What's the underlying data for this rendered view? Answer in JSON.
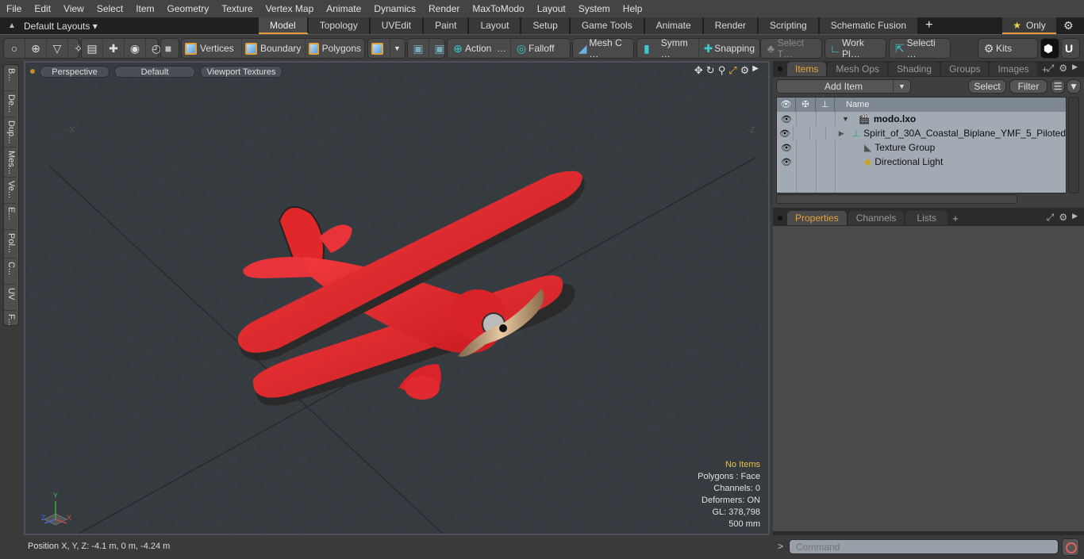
{
  "menu": [
    "File",
    "Edit",
    "View",
    "Select",
    "Item",
    "Geometry",
    "Texture",
    "Vertex Map",
    "Animate",
    "Dynamics",
    "Render",
    "MaxToModo",
    "Layout",
    "System",
    "Help"
  ],
  "layoutbar": {
    "layouts_dropdown": "Default Layouts ▾",
    "tabs": [
      "Model",
      "Topology",
      "UVEdit",
      "Paint",
      "Layout",
      "Setup",
      "Game Tools",
      "Animate",
      "Render",
      "Scripting",
      "Schematic Fusion"
    ],
    "active_tab": "Model",
    "add_tab": "+",
    "only_label": "Only",
    "star": "★"
  },
  "toolbar": {
    "vertices": "Vertices",
    "boundary": "Boundary",
    "polygons": "Polygons",
    "action": "Action",
    "falloff": "Falloff",
    "mesh_c": "Mesh C …",
    "symm": "Symm …",
    "snapping": "Snapping",
    "select_t": "Select T…",
    "work_pl": "Work Pl…",
    "selecti": "Selecti …",
    "kits": "Kits",
    "ellipsis": "…"
  },
  "left_tools": [
    "B...",
    "De...",
    "Dup...",
    "Mes...",
    "Ve...",
    "E...",
    "Pol...",
    "C...",
    "UV",
    "F..."
  ],
  "viewport": {
    "view_mode": "Perspective",
    "shading": "Default",
    "textures": "Viewport Textures",
    "axis_neg_x": "-X",
    "axis_neg_z": "-Z",
    "gizmo": {
      "x": "X",
      "y": "Y",
      "z": "Z"
    },
    "hud": {
      "selection": "No Items",
      "polygons": "Polygons : Face",
      "channels": "Channels: 0",
      "deformers": "Deformers: ON",
      "gl": "GL: 378,798",
      "scale": "500 mm"
    }
  },
  "status": {
    "position": "Position X, Y, Z:   -4.1 m, 0 m, -4.24 m"
  },
  "items_panel": {
    "tabs": [
      "Items",
      "Mesh Ops",
      "Shading",
      "Groups",
      "Images"
    ],
    "active_tab": "Items",
    "add_item": "Add Item",
    "select": "Select",
    "filter": "Filter",
    "column_name": "Name",
    "tree": [
      {
        "label": "modo.lxo",
        "bold": true,
        "expander": "▼",
        "icon": "🎬"
      },
      {
        "label": "Spirit_of_30A_Coastal_Biplane_YMF_5_Piloted",
        "bold": false,
        "expander": "▶",
        "icon": "┴"
      },
      {
        "label": "Texture Group",
        "bold": false,
        "expander": "",
        "icon": "◣"
      },
      {
        "label": "Directional Light",
        "bold": false,
        "expander": "",
        "icon": "◆"
      }
    ]
  },
  "properties_panel": {
    "tabs": [
      "Properties",
      "Channels",
      "Lists"
    ],
    "active_tab": "Properties"
  },
  "command": {
    "prompt": ">",
    "placeholder": "Command"
  },
  "colors": {
    "accent": "#e69d3c",
    "plane_red": "#e8292c",
    "viewport_bg": "#363b40",
    "items_bg": "#a2aab3"
  }
}
